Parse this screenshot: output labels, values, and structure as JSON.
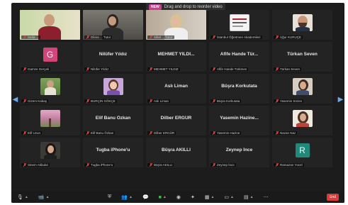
{
  "banner": {
    "badge": "NEW",
    "text": "Drag and drop to reorder video"
  },
  "tiles": [
    {
      "kind": "video",
      "label": "Seda ...",
      "active": true,
      "scene": "woman-green-wall"
    },
    {
      "kind": "video",
      "label": "Dilara ... Tutor",
      "scene": "woman-dark-hair"
    },
    {
      "kind": "video",
      "label": "Sibel ... Tutor",
      "scene": "woman-blonde"
    },
    {
      "kind": "photo",
      "label": "İstanbul Öğretmen Akademileri",
      "scene": "logo"
    },
    {
      "kind": "photo",
      "label": "Uğur KURUÇE",
      "scene": "man-beard"
    },
    {
      "kind": "avatar",
      "label": "Gamze Gerçek",
      "initial": "G",
      "color": "#d2457a"
    },
    {
      "kind": "name",
      "name": "Nilüfer Yıldız",
      "label": "Nilüfer Yıldız"
    },
    {
      "kind": "name",
      "name": "MEHMET YILDI...",
      "label": "MEHMET YILDIZ"
    },
    {
      "kind": "name",
      "name": "Afife Hande Tür...",
      "label": "Afife Hande Türkmen"
    },
    {
      "kind": "name",
      "name": "Türkan Seven",
      "label": "Türkan Seven"
    },
    {
      "kind": "photo",
      "label": "Gizem Kabaş",
      "scene": "outdoor-person"
    },
    {
      "kind": "photo",
      "label": "BURÇIN GÖKÇE",
      "scene": "cartoon"
    },
    {
      "kind": "name",
      "name": "Aslı Liman",
      "label": "Aslı Liman"
    },
    {
      "kind": "name",
      "name": "Büşra Korkutata",
      "label": "Büşra Korkutata"
    },
    {
      "kind": "photo",
      "label": "Yasemin Sözen",
      "scene": "woman-photo"
    },
    {
      "kind": "photo",
      "label": "Elif Uzun",
      "scene": "pink-tree"
    },
    {
      "kind": "name",
      "name": "Elif Banu Özkan",
      "label": "Elif Banu Özkan"
    },
    {
      "kind": "name",
      "name": "Dilber ERGÜR",
      "label": "Dilber ERGÜR"
    },
    {
      "kind": "name",
      "name": "Yasemin Hazine...",
      "label": "Yasemin Hazine"
    },
    {
      "kind": "photo",
      "label": "Nazan Naz",
      "scene": "woman-curly"
    },
    {
      "kind": "photo",
      "label": "Sinem Akbulut",
      "scene": "woman-dark-photo"
    },
    {
      "kind": "name",
      "name": "Tugba iPhone'u",
      "label": "Tugba iPhone'u"
    },
    {
      "kind": "name",
      "name": "Büşra AKILLI",
      "label": "Büşra AKILLI"
    },
    {
      "kind": "name",
      "name": "Zeynep İnce",
      "label": "Zeynep İnce"
    },
    {
      "kind": "avatar",
      "label": "Ramazan Yücel",
      "initial": "R",
      "color": "#1f8a7a"
    }
  ],
  "toolbar": {
    "end_label": "End"
  },
  "colors": {
    "active_outline": "#b4e04a",
    "mute": "#d94040",
    "arrow": "#6aa8e8",
    "end": "#d93a3a"
  }
}
